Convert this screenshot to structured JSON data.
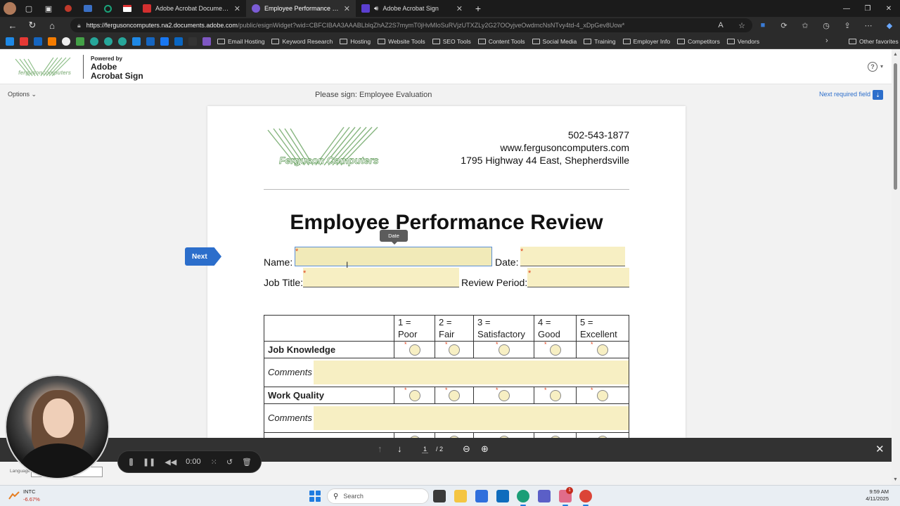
{
  "browser": {
    "tabs": [
      {
        "title": "Adobe Acrobat Documents",
        "active": false,
        "favicon_color": "#d32f2f"
      },
      {
        "title": "Employee Performance Review W",
        "active": true,
        "favicon_color": "#7b5cd6"
      },
      {
        "title": "Adobe Acrobat Sign",
        "active": false,
        "favicon_color": "#5b3fd0"
      }
    ],
    "url_host": "https://fergusoncomputers.na2.documents.adobe.com",
    "url_path": "/public/esignWidget?wid=CBFCIBAA3AAABLblqZhAZ2S7mymT0jHvMIoSuRVjzUTXZLy2G27OOyjveOwdmcNsNTvy4td-4_xDpGev8Uow*",
    "bookmarks": [
      "Email Hosting",
      "Keyword Research",
      "Hosting",
      "Website Tools",
      "SEO Tools",
      "Content Tools",
      "Social Media",
      "Training",
      "Employer Info",
      "Competitors",
      "Vendors"
    ],
    "other_favorites": "Other favorites"
  },
  "sign_header": {
    "powered_by": "Powered by",
    "product_line1": "Adobe",
    "product_line2": "Acrobat Sign",
    "options": "Options",
    "please_sign": "Please sign: Employee Evaluation",
    "next_required": "Next required field"
  },
  "document": {
    "company_logo_text": "Ferguson Computers",
    "phone": "502-543-1877",
    "website": "www.fergusoncomputers.com",
    "address": "1795 Highway 44 East, Shepherdsville",
    "title": "Employee Performance Review",
    "fields": {
      "name_label": "Name:",
      "date_label": "Date:",
      "job_title_label": "Job Title:",
      "review_period_label": "Review Period:",
      "date_tooltip": "Date"
    },
    "rating_headers": [
      {
        "num": "1 =",
        "word": "Poor"
      },
      {
        "num": "2 =",
        "word": "Fair"
      },
      {
        "num": "3 =",
        "word": "Satisfactory"
      },
      {
        "num": "4 =",
        "word": "Good"
      },
      {
        "num": "5 =",
        "word": "Excellent"
      }
    ],
    "criteria": [
      "Job Knowledge",
      "Work Quality"
    ],
    "comments_label": "Comments",
    "next_flag": "Next"
  },
  "page_controls": {
    "current_page": "1",
    "total_pages": "/ 2"
  },
  "language": {
    "label": "Language"
  },
  "recorder": {
    "time": "0:00"
  },
  "taskbar": {
    "stock_name": "INTC",
    "stock_change": "-6.67%",
    "search_placeholder": "Search",
    "time": "9:59 AM",
    "date": "4/11/2025",
    "mail_badge": "1"
  },
  "colors": {
    "accent_blue": "#2c6ecb",
    "field_fill": "#f7efc3",
    "required_star": "#e0411b"
  }
}
